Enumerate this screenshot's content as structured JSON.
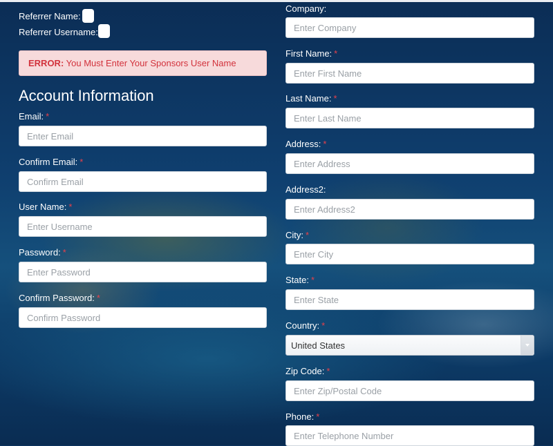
{
  "referrer": {
    "name_label": "Referrer Name:",
    "username_label": "Referrer Username:"
  },
  "error": {
    "prefix": "ERROR:",
    "message": "You Must Enter Your Sponsors User Name"
  },
  "account_section": {
    "title": "Account Information",
    "required_marker": "*",
    "fields": {
      "email": {
        "label": "Email:",
        "placeholder": "Enter Email"
      },
      "confirm_email": {
        "label": "Confirm Email:",
        "placeholder": "Confirm Email"
      },
      "username": {
        "label": "User Name:",
        "placeholder": "Enter Username"
      },
      "password": {
        "label": "Password:",
        "placeholder": "Enter Password"
      },
      "confirm_password": {
        "label": "Confirm Password:",
        "placeholder": "Confirm Password"
      }
    }
  },
  "personal_section": {
    "fields": {
      "company": {
        "label": "Company:",
        "placeholder": "Enter Company"
      },
      "first_name": {
        "label": "First Name:",
        "placeholder": "Enter First Name"
      },
      "last_name": {
        "label": "Last Name:",
        "placeholder": "Enter Last Name"
      },
      "address": {
        "label": "Address:",
        "placeholder": "Enter Address"
      },
      "address2": {
        "label": "Address2:",
        "placeholder": "Enter Address2"
      },
      "city": {
        "label": "City:",
        "placeholder": "Enter City"
      },
      "state": {
        "label": "State:",
        "placeholder": "Enter State"
      },
      "country": {
        "label": "Country:",
        "selected": "United States"
      },
      "zip": {
        "label": "Zip Code:",
        "placeholder": "Enter Zip/Postal Code"
      },
      "phone": {
        "label": "Phone:",
        "placeholder": "Enter Telephone Number"
      }
    }
  },
  "colors": {
    "required": "#e8414a",
    "error_text": "#d2323c",
    "error_bg": "#f7dadb",
    "background": "#0d3560"
  }
}
